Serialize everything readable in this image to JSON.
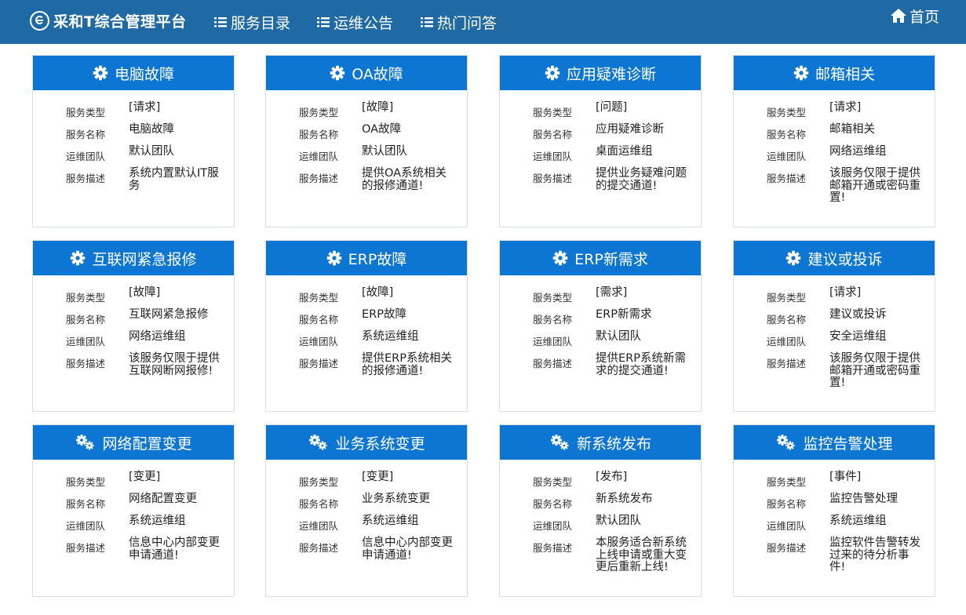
{
  "header": {
    "brand": "采和T综合管理平台",
    "nav": [
      {
        "label": "服务目录"
      },
      {
        "label": "运维公告"
      },
      {
        "label": "热门问答"
      }
    ],
    "home": "首页"
  },
  "labels": {
    "type": "服务类型",
    "name": "服务名称",
    "team": "运维团队",
    "desc": "服务描述"
  },
  "cards": [
    {
      "title": "电脑故障",
      "icon": "gear-icon",
      "type": "[请求]",
      "name": "电脑故障",
      "team": "默认团队",
      "desc": "系统内置默认IT服务"
    },
    {
      "title": "OA故障",
      "icon": "gear-icon",
      "type": "[故障]",
      "name": "OA故障",
      "team": "默认团队",
      "desc": "提供OA系统相关的报修通道!"
    },
    {
      "title": "应用疑难诊断",
      "icon": "gear-icon",
      "type": "[问题]",
      "name": "应用疑难诊断",
      "team": "桌面运维组",
      "desc": "提供业务疑难问题的提交通道!"
    },
    {
      "title": "邮箱相关",
      "icon": "gear-icon",
      "type": "[请求]",
      "name": "邮箱相关",
      "team": "网络运维组",
      "desc": "该服务仅限于提供邮箱开通或密码重置!"
    },
    {
      "title": "互联网紧急报修",
      "icon": "gear-icon",
      "type": "[故障]",
      "name": "互联网紧急报修",
      "team": "网络运维组",
      "desc": "该服务仅限于提供互联网断网报修!"
    },
    {
      "title": "ERP故障",
      "icon": "gear-icon",
      "type": "[故障]",
      "name": "ERP故障",
      "team": "系统运维组",
      "desc": "提供ERP系统相关的报修通道!"
    },
    {
      "title": "ERP新需求",
      "icon": "gear-icon",
      "type": "[需求]",
      "name": "ERP新需求",
      "team": "默认团队",
      "desc": "提供ERP系统新需求的提交通道!"
    },
    {
      "title": "建议或投诉",
      "icon": "gear-icon",
      "type": "[请求]",
      "name": "建议或投诉",
      "team": "安全运维组",
      "desc": "该服务仅限于提供邮箱开通或密码重置!"
    },
    {
      "title": "网络配置变更",
      "icon": "gears-icon",
      "type": "[变更]",
      "name": "网络配置变更",
      "team": "系统运维组",
      "desc": "信息中心内部变更申请通道!"
    },
    {
      "title": "业务系统变更",
      "icon": "gears-icon",
      "type": "[变更]",
      "name": "业务系统变更",
      "team": "系统运维组",
      "desc": "信息中心内部变更申请通道!"
    },
    {
      "title": "新系统发布",
      "icon": "gears-icon",
      "type": "[发布]",
      "name": "新系统发布",
      "team": "默认团队",
      "desc": "本服务适合新系统上线申请或重大变更后重新上线!"
    },
    {
      "title": "监控告警处理",
      "icon": "gears-icon",
      "type": "[事件]",
      "name": "监控告警处理",
      "team": "系统运维组",
      "desc": "监控软件告警转发过来的待分析事件!"
    }
  ]
}
